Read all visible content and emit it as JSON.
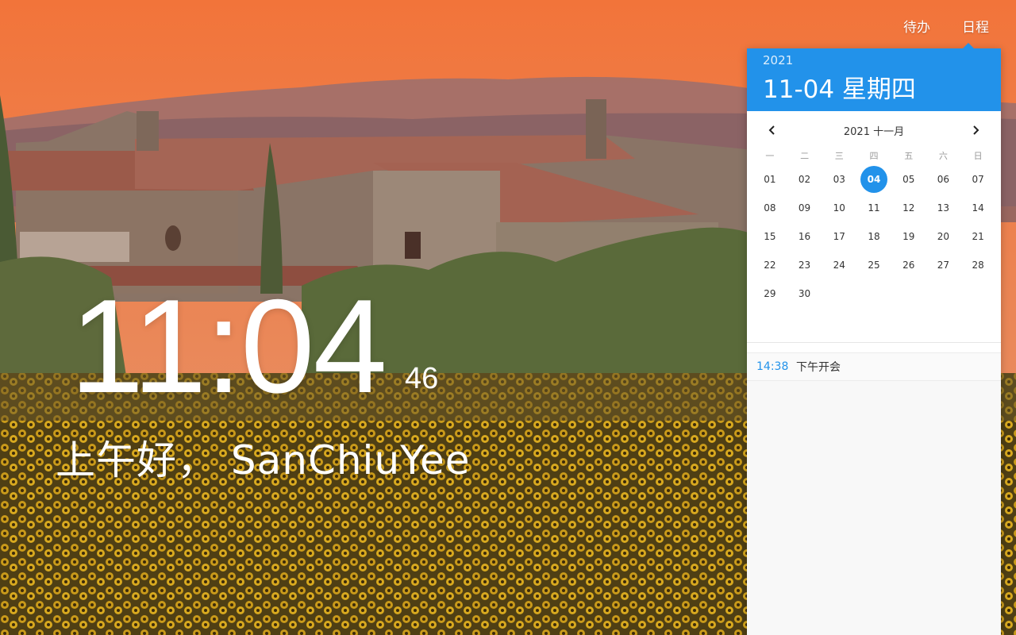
{
  "nav": {
    "todo_label": "待办",
    "schedule_label": "日程"
  },
  "clock": {
    "time": "11:04",
    "seconds": "46"
  },
  "greeting": "上午好， SanChiuYee",
  "calendar": {
    "header_year": "2021",
    "header_date": "11-04 星期四",
    "month_label": "2021 十一月",
    "weekdays": [
      "一",
      "二",
      "三",
      "四",
      "五",
      "六",
      "日"
    ],
    "days": [
      "01",
      "02",
      "03",
      "04",
      "05",
      "06",
      "07",
      "08",
      "09",
      "10",
      "11",
      "12",
      "13",
      "14",
      "15",
      "16",
      "17",
      "18",
      "19",
      "20",
      "21",
      "22",
      "23",
      "24",
      "25",
      "26",
      "27",
      "28",
      "29",
      "30"
    ],
    "selected_day": "04",
    "accent_color": "#2292ea"
  },
  "events": [
    {
      "time": "14:38",
      "title": "下午开会"
    }
  ],
  "icons": {
    "prev": "chevron-left-icon",
    "next": "chevron-right-icon"
  }
}
